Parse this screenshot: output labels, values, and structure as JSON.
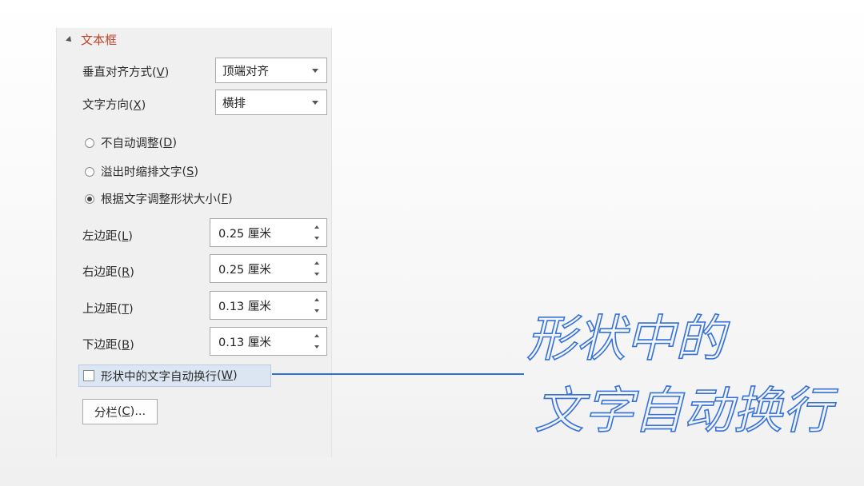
{
  "section": {
    "title": "文本框"
  },
  "vertical_align": {
    "label": "垂直对齐方式",
    "key": "V",
    "value": "顶端对齐"
  },
  "text_direction": {
    "label": "文字方向",
    "key": "X",
    "value": "横排"
  },
  "autofit": {
    "options": [
      {
        "label": "不自动调整",
        "key": "D",
        "selected": false
      },
      {
        "label": "溢出时缩排文字",
        "key": "S",
        "selected": false
      },
      {
        "label": "根据文字调整形状大小",
        "key": "F",
        "selected": true
      }
    ]
  },
  "margins": {
    "left": {
      "label": "左边距",
      "key": "L",
      "value": "0.25 厘米"
    },
    "right": {
      "label": "右边距",
      "key": "R",
      "value": "0.25 厘米"
    },
    "top": {
      "label": "上边距",
      "key": "T",
      "value": "0.13 厘米"
    },
    "bottom": {
      "label": "下边距",
      "key": "B",
      "value": "0.13 厘米"
    }
  },
  "wrap_text": {
    "label": "形状中的文字自动换行",
    "key": "W",
    "checked": false
  },
  "columns_button": {
    "label": "分栏",
    "key": "C",
    "suffix": "..."
  },
  "callout": {
    "line1": "形状中的",
    "line2": "文字自动换行"
  },
  "colors": {
    "accent": "#c4432a",
    "callout": "#3572d9",
    "highlight": "#dce6f3"
  }
}
